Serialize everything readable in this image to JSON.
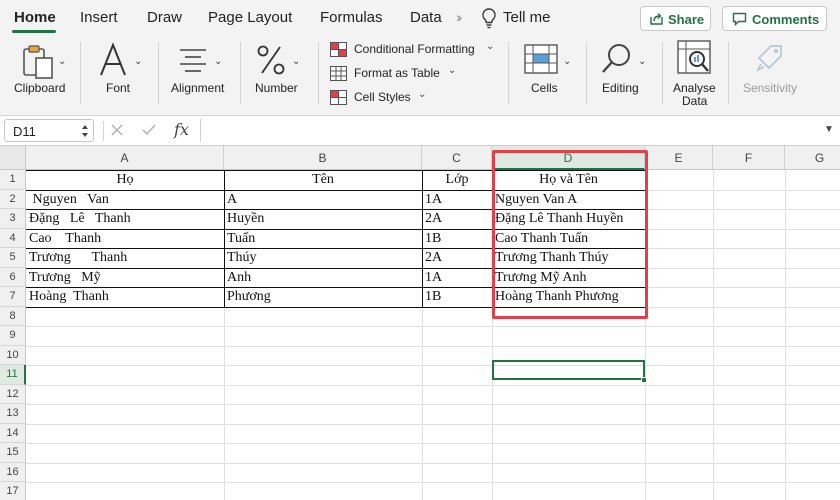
{
  "tabs": {
    "items": [
      "Home",
      "Insert",
      "Draw",
      "Page Layout",
      "Formulas",
      "Data"
    ],
    "active": "Home",
    "tell_me": "Tell me",
    "share_label": "Share",
    "comments_label": "Comments"
  },
  "ribbon": {
    "clipboard": "Clipboard",
    "font": "Font",
    "alignment": "Alignment",
    "number": "Number",
    "conditional_formatting": "Conditional Formatting",
    "format_as_table": "Format as Table",
    "cell_styles": "Cell Styles",
    "cells": "Cells",
    "editing": "Editing",
    "analyse_line1": "Analyse",
    "analyse_line2": "Data",
    "sensitivity": "Sensitivity"
  },
  "formula_bar": {
    "name_box": "D11",
    "fx": "fx",
    "value": ""
  },
  "colors": {
    "accent": "#217346",
    "highlight_box": "#e0404a"
  },
  "sheet": {
    "columns": [
      "A",
      "B",
      "C",
      "D",
      "E",
      "F",
      "G"
    ],
    "rows": [
      "1",
      "2",
      "3",
      "4",
      "5",
      "6",
      "7",
      "8",
      "9",
      "10",
      "11",
      "12",
      "13",
      "14",
      "15",
      "16",
      "17"
    ],
    "selected_cell": "D11",
    "header": [
      "Họ",
      "Tên",
      "Lớp",
      "Họ và Tên"
    ],
    "data": [
      [
        " Nguyen   Van",
        "A",
        "1A",
        "Nguyen Van A"
      ],
      [
        "Đặng   Lê   Thanh",
        "Huyền",
        "2A",
        "Đặng Lê Thanh Huyền"
      ],
      [
        "Cao    Thanh",
        "Tuấn",
        "1B",
        "Cao Thanh Tuấn"
      ],
      [
        "Trương      Thanh",
        "Thúy",
        "2A",
        "Trương Thanh Thúy"
      ],
      [
        "Trương   Mỹ",
        "Anh",
        "1A",
        "Trương Mỹ Anh"
      ],
      [
        "Hoàng  Thanh",
        "Phương",
        "1B",
        "Hoàng Thanh Phương"
      ]
    ]
  }
}
